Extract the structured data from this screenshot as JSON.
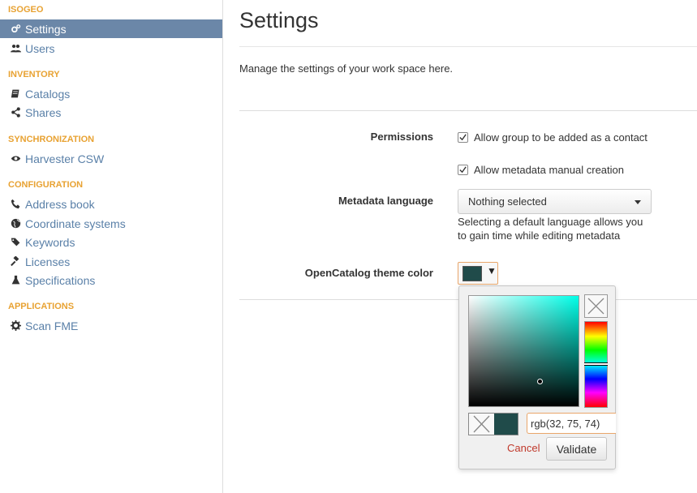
{
  "sidebar": {
    "sections": {
      "isogeo": "ISOGEO",
      "inventory": "INVENTORY",
      "synchronization": "SYNCHRONIZATION",
      "configuration": "CONFIGURATION",
      "applications": "APPLICATIONS"
    },
    "items": {
      "settings": {
        "label": "Settings",
        "icon": "cogs-icon"
      },
      "users": {
        "label": "Users",
        "icon": "users-icon"
      },
      "catalogs": {
        "label": "Catalogs",
        "icon": "book-icon"
      },
      "shares": {
        "label": "Shares",
        "icon": "share-icon"
      },
      "harvester": {
        "label": "Harvester CSW",
        "icon": "eye-icon"
      },
      "address_book": {
        "label": "Address book",
        "icon": "phone-icon"
      },
      "coordinate_systems": {
        "label": "Coordinate systems",
        "icon": "globe-icon"
      },
      "keywords": {
        "label": "Keywords",
        "icon": "tags-icon"
      },
      "licenses": {
        "label": "Licenses",
        "icon": "gavel-icon"
      },
      "specifications": {
        "label": "Specifications",
        "icon": "flask-icon"
      },
      "scan_fme": {
        "label": "Scan FME",
        "icon": "cog-icon"
      }
    },
    "active": "settings"
  },
  "main": {
    "title": "Settings",
    "intro": "Manage the settings of your work space here.",
    "permissions": {
      "label": "Permissions",
      "options": [
        {
          "label": "Allow group to be added as a contact",
          "checked": true
        },
        {
          "label": "Allow metadata manual creation",
          "checked": true
        }
      ]
    },
    "metadata_language": {
      "label": "Metadata language",
      "selected": "Nothing selected",
      "help": "Selecting a default language allows you to gain time while editing metadata"
    },
    "theme_color": {
      "label": "OpenCatalog theme color",
      "value": "#204b4a"
    }
  },
  "color_picker": {
    "input_value": "rgb(32, 75, 74)",
    "cancel_label": "Cancel",
    "validate_label": "Validate",
    "current_color": "#204b4a",
    "hue_color": "#00ffe8"
  },
  "colors": {
    "accent": "#e8a232",
    "link": "#5a80a8",
    "active_bg": "#6b87a8",
    "cancel": "#c0392b"
  }
}
